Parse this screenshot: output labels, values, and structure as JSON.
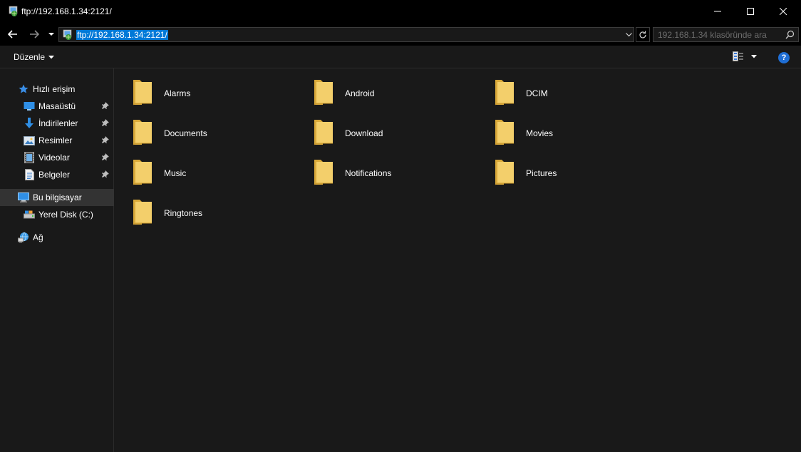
{
  "window": {
    "title": "ftp://192.168.1.34:2121/"
  },
  "address": {
    "value": "ftp://192.168.1.34:2121/"
  },
  "search": {
    "placeholder": "192.168.1.34 klasöründe ara"
  },
  "toolbar": {
    "organize_label": "Düzenle",
    "help_label": "?"
  },
  "sidebar": {
    "quick_access": {
      "label": "Hızlı erişim"
    },
    "items": [
      {
        "label": "Masaüstü",
        "icon": "desktop-icon",
        "pinned": true
      },
      {
        "label": "İndirilenler",
        "icon": "download-icon",
        "pinned": true
      },
      {
        "label": "Resimler",
        "icon": "pictures-icon",
        "pinned": true
      },
      {
        "label": "Videolar",
        "icon": "videos-icon",
        "pinned": true
      },
      {
        "label": "Belgeler",
        "icon": "documents-icon",
        "pinned": true
      }
    ],
    "this_pc": {
      "label": "Bu bilgisayar"
    },
    "local_disk": {
      "label": "Yerel Disk (C:)"
    },
    "network": {
      "label": "Ağ"
    }
  },
  "folders": [
    {
      "name": "Alarms"
    },
    {
      "name": "Android"
    },
    {
      "name": "DCIM"
    },
    {
      "name": "Documents"
    },
    {
      "name": "Download"
    },
    {
      "name": "Movies"
    },
    {
      "name": "Music"
    },
    {
      "name": "Notifications"
    },
    {
      "name": "Pictures"
    },
    {
      "name": "Ringtones"
    }
  ],
  "colors": {
    "background": "#191919",
    "titlebar": "#000000",
    "selection": "#0078d7",
    "folder": "#f3cf6b",
    "folder_dark": "#d9a93a"
  }
}
